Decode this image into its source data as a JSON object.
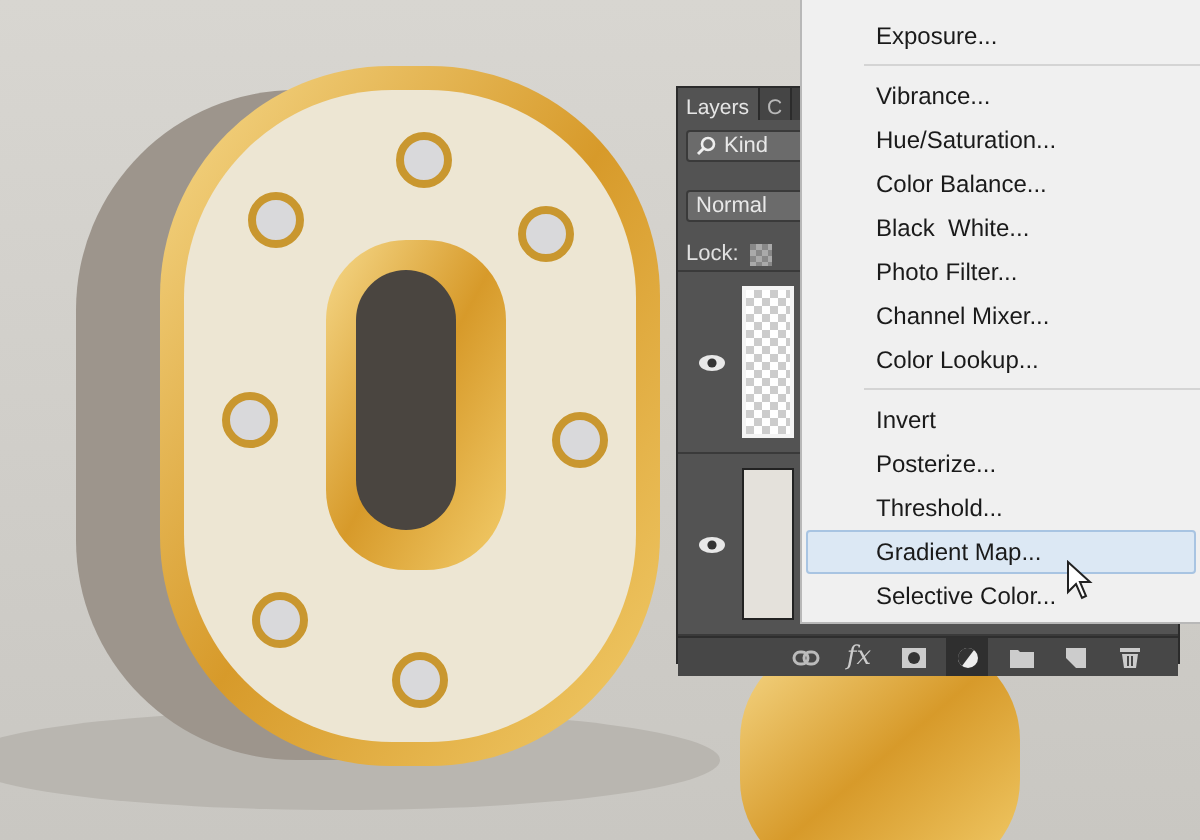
{
  "panel": {
    "tabs": [
      {
        "label": "Layers",
        "selected": true
      },
      {
        "label": "C",
        "selected": false
      }
    ],
    "filter": {
      "value": "Kind"
    },
    "blend_mode": {
      "value": "Normal"
    },
    "lock_label": "Lock:",
    "layers": [
      {
        "visible": true,
        "selected": true,
        "kind": "transparent"
      },
      {
        "visible": true,
        "selected": false,
        "kind": "fill"
      }
    ],
    "toolbar": [
      {
        "kind": "link",
        "pressed": false
      },
      {
        "kind": "fx",
        "label": "fx",
        "pressed": false
      },
      {
        "kind": "mask",
        "pressed": false
      },
      {
        "kind": "adjustment",
        "pressed": true
      },
      {
        "kind": "folder",
        "pressed": false
      },
      {
        "kind": "new",
        "pressed": false
      },
      {
        "kind": "trash",
        "pressed": false
      }
    ]
  },
  "menu": {
    "items": [
      {
        "kind": "item",
        "label": "Exposure...",
        "selected": false
      },
      {
        "kind": "separator"
      },
      {
        "kind": "item",
        "label": "Vibrance...",
        "selected": false
      },
      {
        "kind": "item",
        "label": "Hue/Saturation...",
        "selected": false
      },
      {
        "kind": "item",
        "label": "Color Balance...",
        "selected": false
      },
      {
        "kind": "item",
        "label": "Black  White...",
        "selected": false
      },
      {
        "kind": "item",
        "label": "Photo Filter...",
        "selected": false
      },
      {
        "kind": "item",
        "label": "Channel Mixer...",
        "selected": false
      },
      {
        "kind": "item",
        "label": "Color Lookup...",
        "selected": false
      },
      {
        "kind": "separator"
      },
      {
        "kind": "item",
        "label": "Invert",
        "selected": false
      },
      {
        "kind": "item",
        "label": "Posterize...",
        "selected": false
      },
      {
        "kind": "item",
        "label": "Threshold...",
        "selected": false
      },
      {
        "kind": "item",
        "label": "Gradient Map...",
        "selected": true
      },
      {
        "kind": "item",
        "label": "Selective Color...",
        "selected": false
      }
    ]
  }
}
